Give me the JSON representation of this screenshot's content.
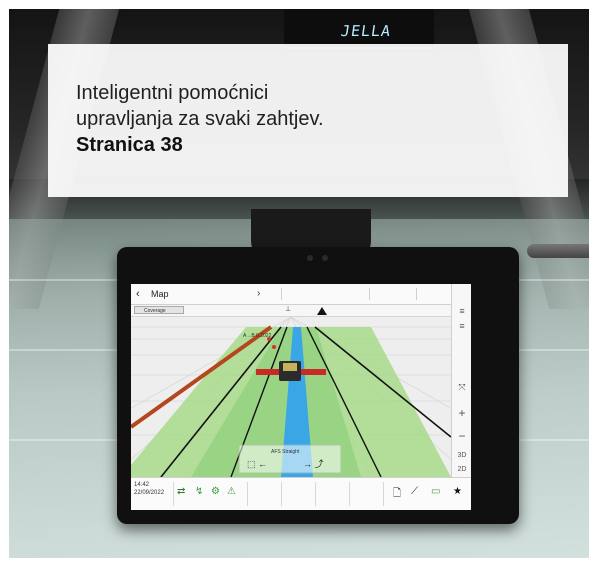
{
  "caption": {
    "line1": "Inteligentni pomoćnici",
    "line2": "upravljanja za svaki zahtjev.",
    "page_ref": "Stranica 38"
  },
  "radio": {
    "display_text": "JELLA"
  },
  "terminal": {
    "header": {
      "back_glyph": "‹",
      "title": "Map",
      "forward_glyph": "›"
    },
    "subbar": {
      "coverage_label": "Coverage",
      "marker": "⊥"
    },
    "viewport": {
      "ab_label": "A→B 0.2022",
      "guidance_label": "AFS Straight"
    },
    "side_buttons": [
      "≡",
      "≡",
      "⤧",
      "+",
      "−",
      "3D",
      "2D"
    ],
    "status": {
      "time": "14:42",
      "date": "22/09/2022"
    },
    "bottom_icons": [
      "⇄",
      "↯",
      "⚙",
      "⚠",
      "🗋",
      "⟋",
      "▭",
      "★"
    ],
    "colors": {
      "guidance_line": "#3aa6e6",
      "field_green": "#9bd77e",
      "boundary": "#b4471e",
      "coverage_red": "#d8322b"
    }
  }
}
